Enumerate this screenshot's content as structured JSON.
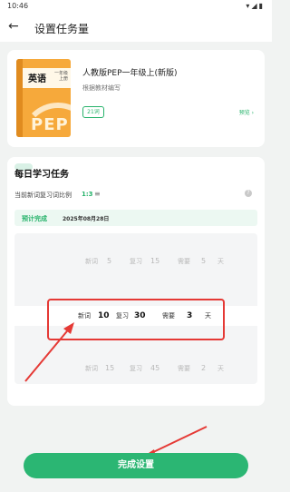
{
  "status_bar": {
    "time": "10:46",
    "icons": "▾◢▮"
  },
  "header": {
    "back_icon": "←",
    "title": "设置任务量"
  },
  "book": {
    "cover_subject": "英语",
    "cover_grade": "一年级上册",
    "cover_logo": "PEP",
    "title": "人教版PEP一年级上(新版)",
    "subtitle": "根据教材编写",
    "word_count": "21词",
    "preview_label": "预览 ›"
  },
  "task": {
    "title": "每日学习任务",
    "ratio_label": "当前新词复习词比例",
    "ratio_value": "1:3",
    "ratio_icon": "≡",
    "help_icon": "?",
    "forecast_label": "预计完成",
    "forecast_date": "2025年08月28日"
  },
  "picker": {
    "rows": [
      {
        "new_label": "新词",
        "new_value": "5",
        "review_label": "复习",
        "review_value": "15",
        "need_label": "需要",
        "days": "5",
        "day_unit": "天"
      },
      {
        "new_label": "新词",
        "new_value": "10",
        "review_label": "复习",
        "review_value": "30",
        "need_label": "需要",
        "days": "3",
        "day_unit": "天"
      },
      {
        "new_label": "新词",
        "new_value": "15",
        "review_label": "复习",
        "review_value": "45",
        "need_label": "需要",
        "days": "2",
        "day_unit": "天"
      }
    ]
  },
  "footer": {
    "done_label": "完成设置"
  },
  "colors": {
    "accent": "#2bb673",
    "annotation": "#e53935"
  }
}
